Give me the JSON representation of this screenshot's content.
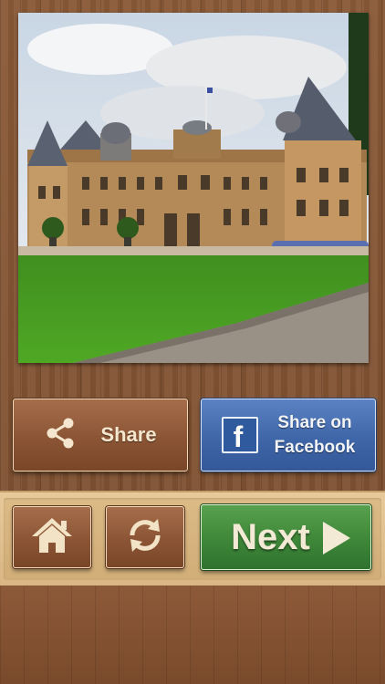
{
  "photo": {
    "subject": "chateau-with-lawn"
  },
  "actions": {
    "share_label": "Share",
    "share_icon": "share-icon",
    "facebook_line1": "Share on",
    "facebook_line2": "Facebook",
    "facebook_icon": "facebook-icon",
    "facebook_glyph": "f"
  },
  "toolbar": {
    "home_icon": "home-icon",
    "refresh_icon": "refresh-icon",
    "next_label": "Next",
    "next_icon": "play-arrow-icon"
  },
  "colors": {
    "wood": "#8a5a38",
    "facebook_blue": "#3f66a8",
    "next_green": "#3e8738",
    "toolbar_tan": "#dcbb87"
  }
}
